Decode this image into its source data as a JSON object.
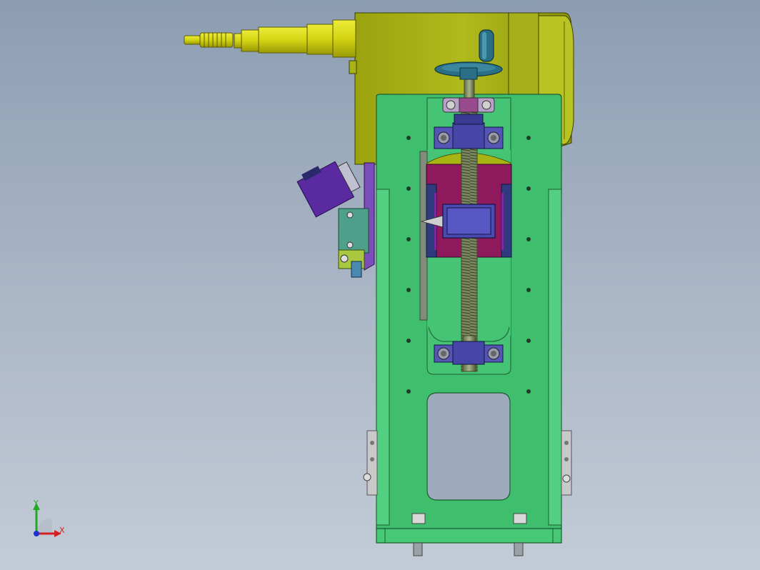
{
  "viewport": {
    "background_top": "#8c9db3",
    "background_bottom": "#c3cbd6"
  },
  "model": {
    "frame_color": "#3fbf6e",
    "housing_color": "#a8b314",
    "fitting_color": "#d9d91a",
    "block_color": "#8e1a5d",
    "bearing_color": "#5555b8",
    "handwheel_color": "#2a6f86",
    "valve_color": "#5a2aa0"
  },
  "triad": {
    "x_label": "X",
    "y_label": "Y",
    "x_color": "#d42020",
    "y_color": "#25a825",
    "z_color": "#2030d0"
  }
}
